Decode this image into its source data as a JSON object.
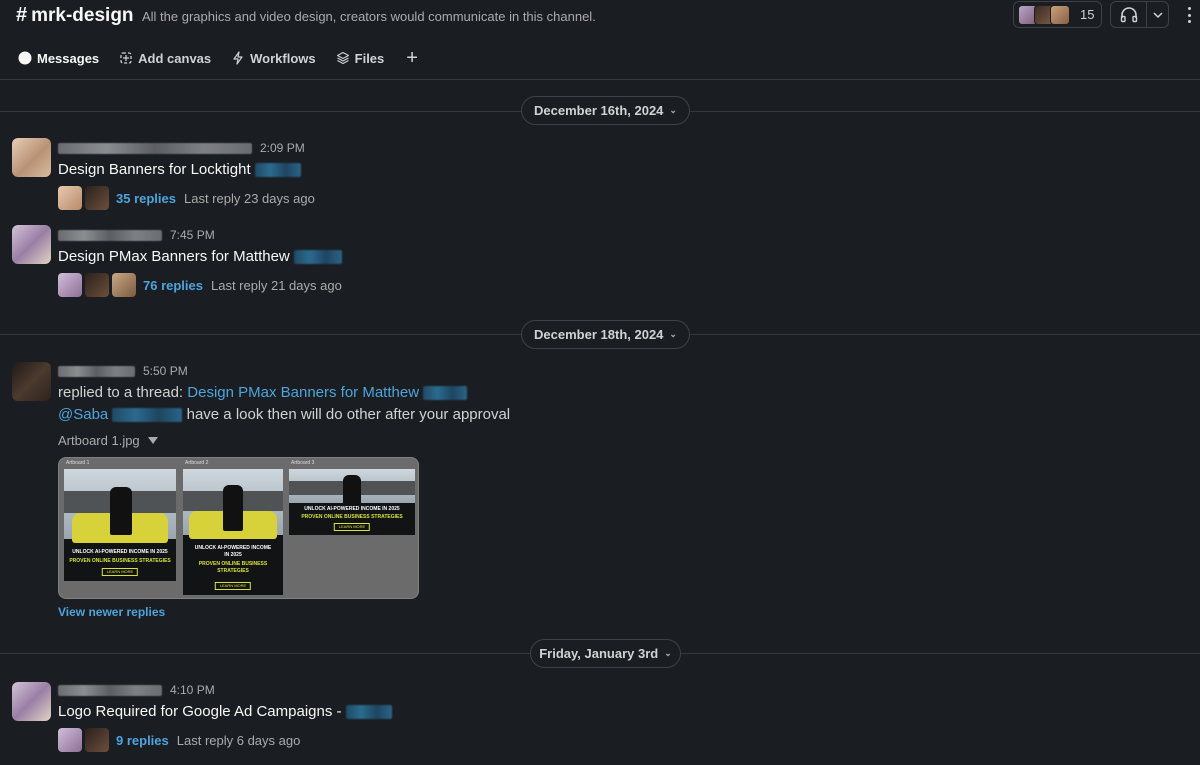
{
  "channel": {
    "hash": "#",
    "name": "mrk-design",
    "description": "All the graphics and video design, creators would communicate in this channel.",
    "member_count": "15"
  },
  "tabs": [
    {
      "label": "Messages",
      "icon": "message-icon"
    },
    {
      "label": "Add canvas",
      "icon": "canvas-icon"
    },
    {
      "label": "Workflows",
      "icon": "lightning-icon"
    },
    {
      "label": "Files",
      "icon": "layers-icon"
    }
  ],
  "dates": {
    "d1": "December 16th, 2024",
    "d2": "December 18th, 2024",
    "d3": "Friday, January 3rd"
  },
  "messages": [
    {
      "time": "2:09 PM",
      "text": "Design Banners for Locktight",
      "replies": "35 replies",
      "last_reply": "Last reply 23 days ago"
    },
    {
      "time": "7:45 PM",
      "text": "Design PMax Banners for Matthew",
      "replies": "76 replies",
      "last_reply": "Last reply 21 days ago"
    },
    {
      "time": "5:50 PM",
      "prefix": "replied to a thread:",
      "thread_link": "Design PMax Banners for Matthew",
      "mention": "@Saba",
      "text": "have a look then will do other after your approval",
      "file_name": "Artboard 1.jpg",
      "view_newer": "View newer replies"
    },
    {
      "time": "4:10 PM",
      "text": "Logo Required for Google Ad Campaigns -",
      "replies": "9 replies",
      "last_reply": "Last reply 6 days ago"
    }
  ],
  "artboards": [
    {
      "label": "Artboard 1",
      "headline": "UNLOCK AI-POWERED INCOME IN 2025",
      "sub": "PROVEN ONLINE BUSINESS STRATEGIES",
      "cta": "LEARN MORE"
    },
    {
      "label": "Artboard 2",
      "headline": "UNLOCK AI-POWERED INCOME IN 2025",
      "sub": "PROVEN ONLINE BUSINESS STRATEGIES",
      "cta": "LEARN MORE"
    },
    {
      "label": "Artboard 3",
      "headline": "UNLOCK AI-POWERED INCOME IN 2025",
      "sub": "PROVEN ONLINE BUSINESS STRATEGIES",
      "cta": "LEARN MORE"
    }
  ],
  "colors": {
    "background": "#1a1d21",
    "link": "#4ea4dc",
    "banner_accent": "#d9e23b"
  }
}
